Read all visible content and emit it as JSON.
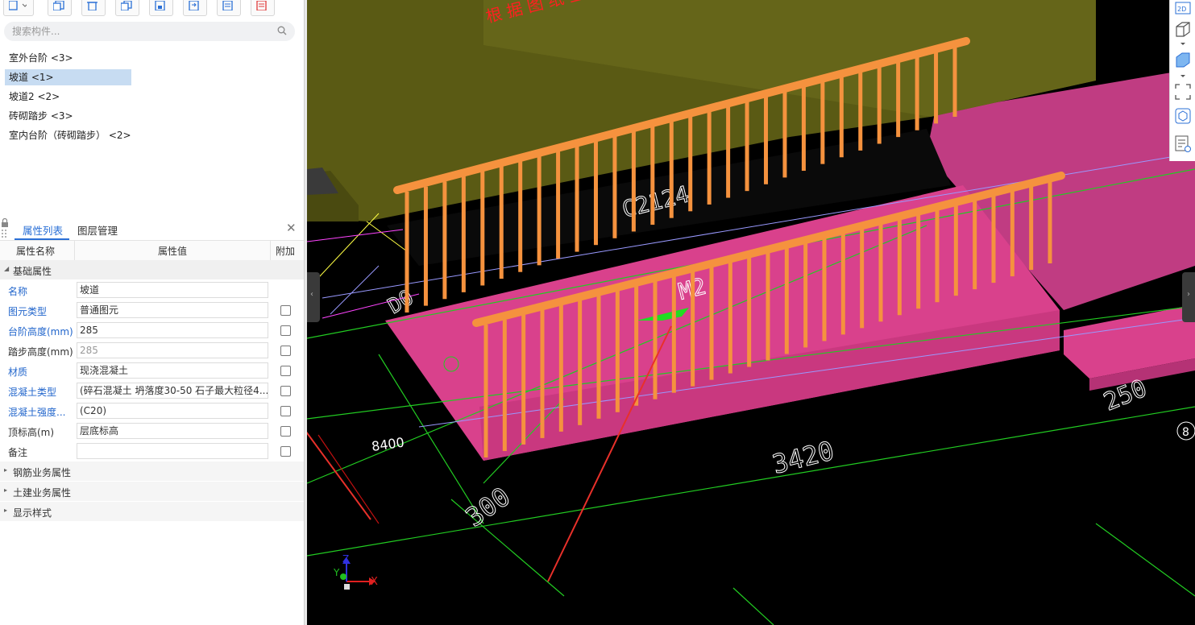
{
  "search": {
    "placeholder": "搜索构件..."
  },
  "components": [
    {
      "label": "室外台阶  <3>"
    },
    {
      "label": "坡道  <1>",
      "selected": true
    },
    {
      "label": "坡道2  <2>"
    },
    {
      "label": "砖砌踏步  <3>"
    },
    {
      "label": "室内台阶（砖砌踏步） <2>"
    }
  ],
  "props": {
    "tabs": [
      "属性列表",
      "图层管理"
    ],
    "columns": {
      "name": "属性名称",
      "value": "属性值",
      "extra": "附加"
    },
    "group_basic": "基础属性",
    "rows": [
      {
        "name": "名称",
        "value": "坡道",
        "blue": true,
        "checkbox": false
      },
      {
        "name": "图元类型",
        "value": "普通图元",
        "blue": true,
        "checkbox": true
      },
      {
        "name": "台阶高度(mm)",
        "value": "285",
        "blue": true,
        "checkbox": true
      },
      {
        "name": "踏步高度(mm)",
        "value": "285",
        "blue": false,
        "gray": true,
        "checkbox": true
      },
      {
        "name": "材质",
        "value": "现浇混凝土",
        "blue": true,
        "checkbox": true
      },
      {
        "name": "混凝土类型",
        "value": "(碎石混凝土 坍落度30-50 石子最大粒径4...",
        "blue": true,
        "checkbox": true
      },
      {
        "name": "混凝土强度...",
        "value": "(C20)",
        "blue": true,
        "checkbox": true
      },
      {
        "name": "顶标高(m)",
        "value": "层底标高",
        "blue": false,
        "checkbox": true
      },
      {
        "name": "备注",
        "value": "",
        "blue": false,
        "checkbox": true
      }
    ],
    "groups_collapsed": [
      "钢筋业务属性",
      "土建业务属性",
      "显示样式"
    ]
  },
  "viewport": {
    "dims": [
      "8400",
      "3420",
      "300",
      "250",
      "8"
    ],
    "labels": [
      "C2124",
      "M2",
      "D0"
    ],
    "banner_text": "根 据 图 纸 生 成",
    "axes": {
      "x": "X",
      "y": "Y",
      "z": "Z"
    },
    "colors": {
      "ramp": "#d9418c",
      "railing": "#f5923e",
      "wall": "#5a5a14",
      "floor": "#c03c82",
      "dim": "#22cc22",
      "annotation_arrow": "#e8302a"
    }
  },
  "right_tools": [
    "2d-icon",
    "view-cube-icon",
    "view-cube-solid-icon",
    "fullscreen-icon",
    "component-3d-icon",
    "list-settings-icon"
  ]
}
